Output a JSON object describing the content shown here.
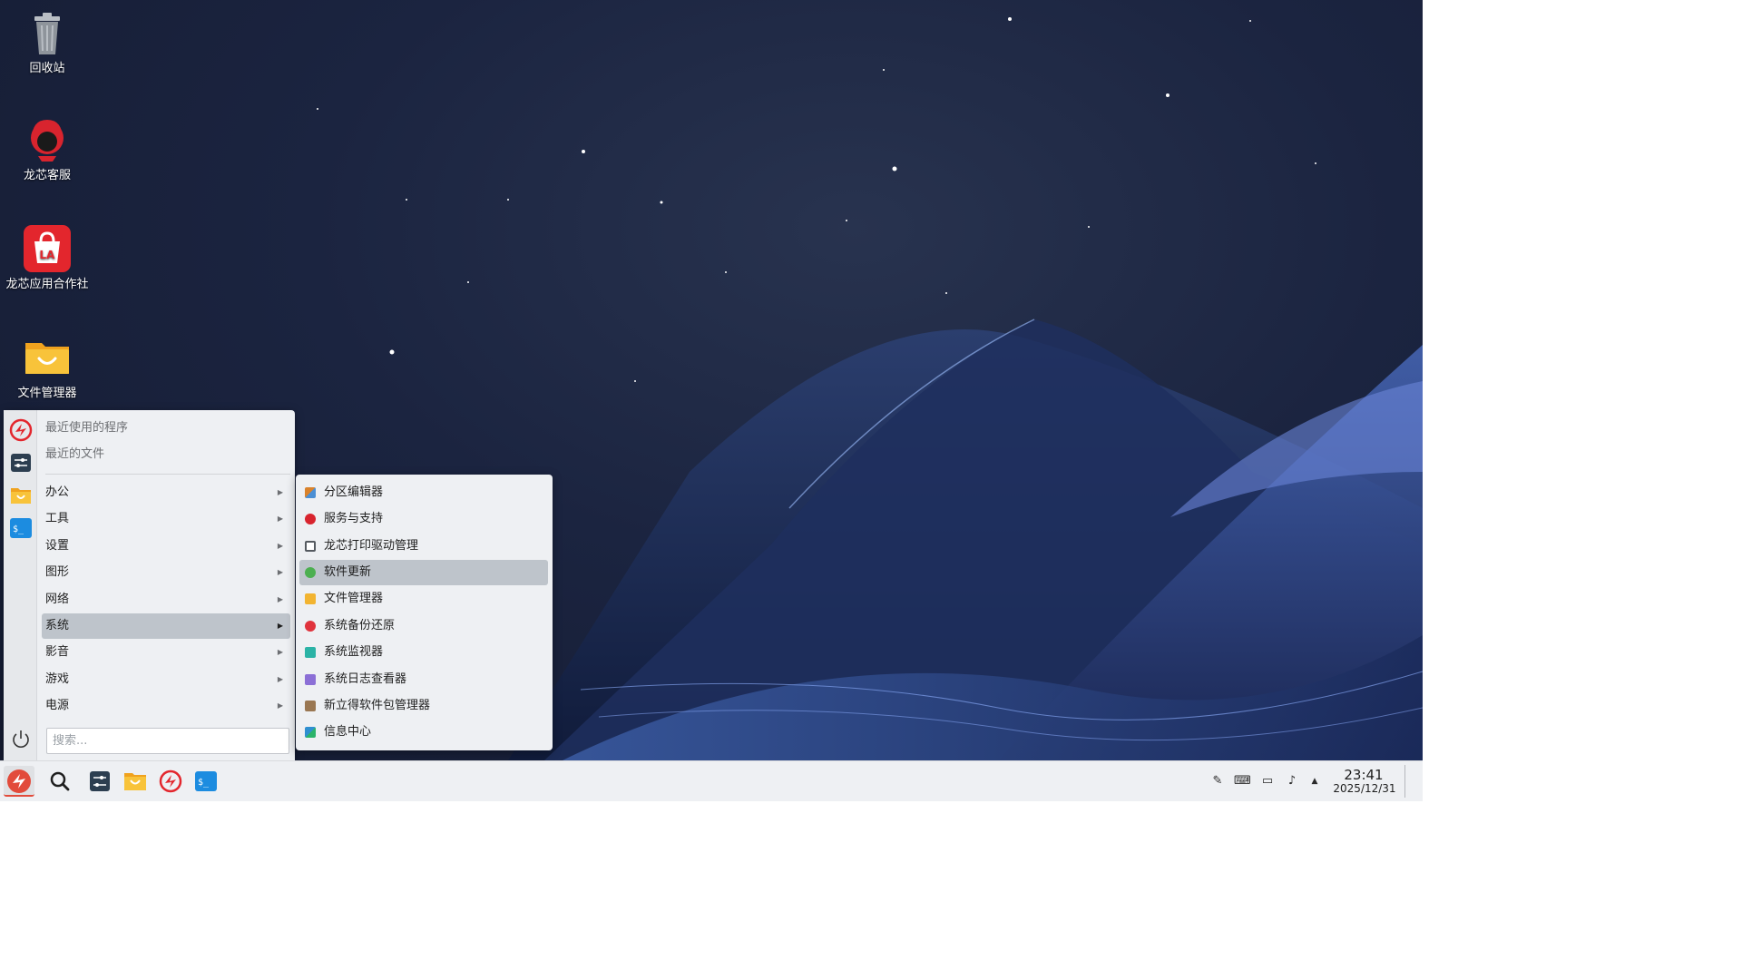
{
  "desktop": {
    "icons": [
      {
        "label": "回收站",
        "icon": "trash-icon"
      },
      {
        "label": "龙芯客服",
        "icon": "customer-service-icon"
      },
      {
        "label": "龙芯应用合作社",
        "icon": "app-store-icon"
      },
      {
        "label": "文件管理器",
        "icon": "folder-icon"
      }
    ]
  },
  "start_menu": {
    "side_buttons": [
      "loongson-logo-icon",
      "settings-icon",
      "file-manager-icon",
      "terminal-icon"
    ],
    "power_icon": "power-icon",
    "top_items": [
      "最近使用的程序",
      "最近的文件"
    ],
    "categories": [
      "办公",
      "工具",
      "设置",
      "图形",
      "网络",
      "系统",
      "影音",
      "游戏",
      "电源"
    ],
    "active_category": "系统",
    "search_placeholder": "搜索..."
  },
  "submenu": {
    "items": [
      {
        "label": "分区编辑器",
        "icon": "partition-editor-icon",
        "color": "#d9822b"
      },
      {
        "label": "服务与支持",
        "icon": "support-icon",
        "color": "#d8242e"
      },
      {
        "label": "龙芯打印驱动管理",
        "icon": "printer-icon",
        "color": "#555a60"
      },
      {
        "label": "软件更新",
        "icon": "update-icon",
        "color": "#4caf50"
      },
      {
        "label": "文件管理器",
        "icon": "folder-icon",
        "color": "#f2b431"
      },
      {
        "label": "系统备份还原",
        "icon": "backup-icon",
        "color": "#e0333c"
      },
      {
        "label": "系统监视器",
        "icon": "monitor-icon",
        "color": "#2bb3a6"
      },
      {
        "label": "系统日志查看器",
        "icon": "log-viewer-icon",
        "color": "#8b6fd6"
      },
      {
        "label": "新立得软件包管理器",
        "icon": "package-manager-icon",
        "color": "#9a7752"
      },
      {
        "label": "信息中心",
        "icon": "info-center-icon",
        "color": "#2f8fd0"
      }
    ],
    "active_item": "软件更新"
  },
  "taskbar": {
    "buttons": [
      "start-menu-icon",
      "search-icon",
      "settings-icon",
      "file-manager-icon",
      "loongson-logo-icon",
      "terminal-icon"
    ],
    "tray": [
      "pen-icon",
      "keyboard-icon",
      "network-icon",
      "volume-icon",
      "chevron-up-icon"
    ],
    "time": "23:41",
    "date": "2025/12/31"
  },
  "colors": {
    "accent_red": "#e24b3b",
    "menu_bg": "#eef0f3",
    "highlight": "#bec4cb"
  }
}
